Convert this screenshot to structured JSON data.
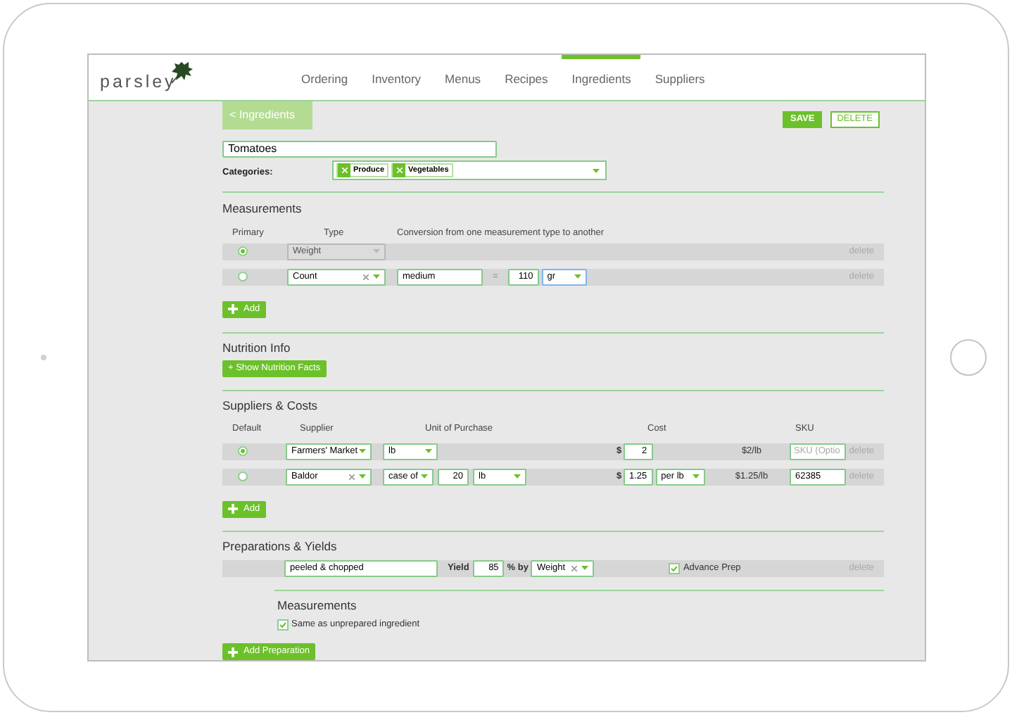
{
  "nav": {
    "logo": "parsley",
    "items": [
      {
        "label": "Ordering",
        "selected": false
      },
      {
        "label": "Inventory",
        "selected": false
      },
      {
        "label": "Menus",
        "selected": false
      },
      {
        "label": "Recipes",
        "selected": false
      },
      {
        "label": "Ingredients",
        "selected": true
      },
      {
        "label": "Suppliers",
        "selected": false
      }
    ]
  },
  "toolbar": {
    "back": "< Ingredients",
    "save": "SAVE",
    "delete": "DELETE"
  },
  "name": {
    "value": "Tomatoes"
  },
  "categories": {
    "label": "Categories:",
    "tags": [
      "Produce",
      "Vegetables"
    ]
  },
  "measurements": {
    "title": "Measurements",
    "columns": [
      "Primary",
      "Type",
      "Conversion from one measurement type to another"
    ],
    "rows": [
      {
        "primary": true,
        "type": "Weight",
        "disabled": true,
        "clearable": false,
        "delete": "delete"
      },
      {
        "primary": false,
        "type": "Count",
        "disabled": false,
        "clearable": true,
        "name": "medium",
        "equals": "=",
        "amount": "110",
        "unit": "gr",
        "delete": "delete"
      }
    ],
    "add": "Add"
  },
  "nutrition": {
    "title": "Nutrition Info",
    "button": "+ Show Nutrition Facts"
  },
  "suppliers": {
    "title": "Suppliers & Costs",
    "columns": [
      "Default",
      "Supplier",
      "Unit of Purchase",
      "Cost",
      "SKU"
    ],
    "rows": [
      {
        "default": true,
        "supplier": "Farmers' Market",
        "clearable": false,
        "unit": "lb",
        "currency": "$",
        "cost": "2",
        "unit_price": "$2/lb",
        "sku_placeholder": "SKU (Optio",
        "delete": "delete"
      },
      {
        "default": false,
        "supplier": "Baldor",
        "clearable": true,
        "unit": "case of",
        "pack_qty": "20",
        "pack_unit": "lb",
        "currency": "$",
        "cost": "1.25",
        "cost_unit": "per lb",
        "unit_price": "$1.25/lb",
        "sku": "62385",
        "delete": "delete"
      }
    ],
    "add": "Add"
  },
  "preparations": {
    "title": "Preparations & Yields",
    "rows": [
      {
        "name": "peeled & chopped",
        "yield_label": "Yield",
        "yield": "85",
        "by_label": "% by",
        "basis": "Weight",
        "clearable": true,
        "advance_prep": {
          "label": "Advance Prep",
          "checked": true
        },
        "delete": "delete"
      }
    ],
    "measurements": {
      "title": "Measurements",
      "same": {
        "label": "Same as unprepared ingredient",
        "checked": true
      }
    },
    "add": "Add Preparation"
  }
}
